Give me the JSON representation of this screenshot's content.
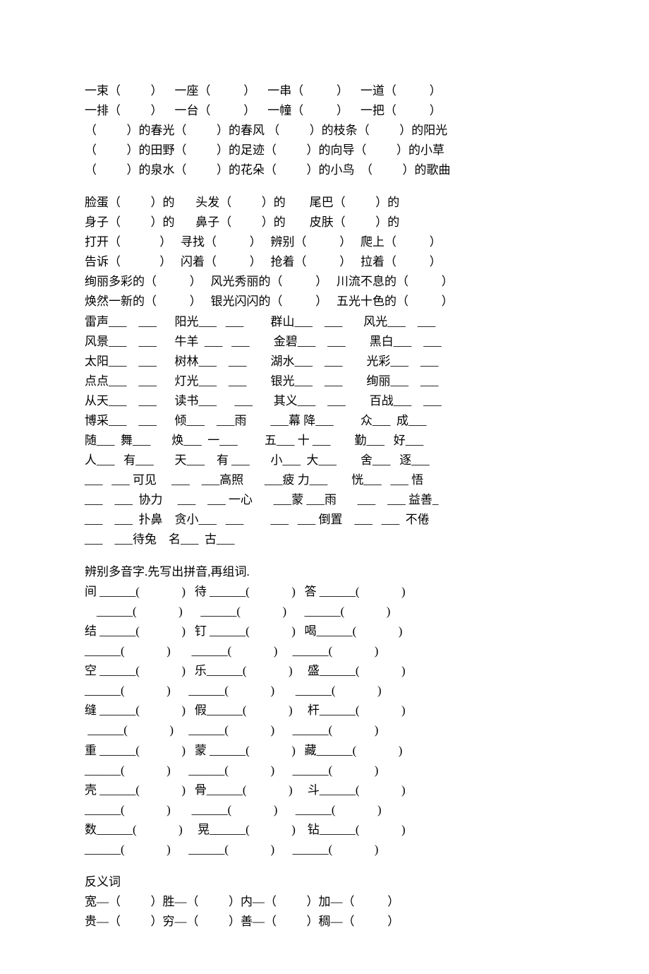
{
  "section1": {
    "l1": "一束（          ）    一座（           ）    一串（           ）    一道（           ）",
    "l2": "一排（          ）    一台（           ）    一幢（           ）    一把（           ）",
    "l3": "（          ）的春光（          ）的春风 （          ）的枝条（          ）的阳光",
    "l4": "（          ）的田野（          ）的足迹（          ）的向导（          ）的小草",
    "l5": "（          ）的泉水（          ）的花朵（          ）的小鸟  （          ）的歌曲"
  },
  "section2": {
    "l1": "脸蛋（          ）的       头发（          ）的        尾巴（          ）的",
    "l2": "身子（          ）的       鼻子（          ）的        皮肤（          ）的",
    "l3": "打开（             ）   寻找（           ）   辨别（           ）   爬上（           ）",
    "l4": "告诉（             ）   闪着（           ）   抢着（           ）   拉着（           ）",
    "l5": "绚丽多彩的（           ）   风光秀丽的（           ）   川流不息的（           ）",
    "l6": "焕然一新的（           ）   银光闪闪的（           ）   五光十色的（           ）",
    "l7": "雷声___    ___      阳光___   ___         群山___    ___       风光___    ___",
    "l8": "风景___    ___      牛羊  ___   ___        金碧___    ___        黑白___    ___",
    "l9": "太阳___    ___      树林___    ___        湖水___    ___        光彩___    ___",
    "l10": "点点___    ___      灯光___    ___        银光___    ___        绚丽___    ___",
    "l11": "从天___    ___      读书___      ___       其义___    ___        百战___    ___",
    "l12": "博采___    ___      倾___    ___雨        ___幕 降___         众___  成___",
    "l13": "随___  舞___       焕___  一___         五___ 十 ___        勤___   好___",
    "l14": "人___   有___       天___    有 ___       小___  大___        舍___   逐___",
    "l15": "___   ___ 可见     ___    ___高照       ___疲 力___        恍___   ___ 悟",
    "l16": "___    ___  协力     ___    ___ 一心       ___蒙 ___雨       ___    ___ 益善_",
    "l17": "___    ___  扑鼻    贪小___   ___         ___   ___ 倒置    ___   ___  不倦",
    "l18": "___    ___待兔    名___  古___"
  },
  "polyphonic": {
    "title": "辨别多音字.先写出拼音,再组词.",
    "rows": [
      {
        "a": "间 ______(              )",
        "b": "待 ______(              )",
        "c": "答 ______(              )"
      },
      {
        "a": "    ______(              )",
        "b": "    ______(              )",
        "c": "    ______(              )"
      },
      {
        "a": "结 ______(              )",
        "b": "钉 ______(              )",
        "c": "喝______(              )"
      },
      {
        "a": "______(              )",
        "b": " ______(              )",
        "c": "______(              )"
      },
      {
        "a": "空 ______(              )",
        "b": "乐______(              )",
        "c": " 盛______(              )"
      },
      {
        "a": "______(              )",
        "b": "______(              )",
        "c": " ______(              )"
      },
      {
        "a": "缝 ______(              )",
        "b": "假______(              )",
        "c": " 杆______(              )"
      },
      {
        "a": " ______(              )",
        "b": "______(              )",
        "c": "______(              )"
      },
      {
        "a": "重 ______(              )",
        "b": "蒙 ______(              )",
        "c": "藏______(              )"
      },
      {
        "a": "______(              )",
        "b": "______(              )",
        "c": "______(              )"
      },
      {
        "a": "壳 ______(              )",
        "b": "骨______(              )",
        "c": " 斗______(              )"
      },
      {
        "a": "______(              )",
        "b": " ______(              )",
        "c": " ______(              )"
      },
      {
        "a": "数______(              )",
        "b": " 晃______(              )",
        "c": " 钻______(              )"
      },
      {
        "a": "______(              )",
        "b": "______(              )",
        "c": "______(              )"
      }
    ]
  },
  "antonyms": {
    "title": "反义词",
    "l1": "宽—（          ）胜—（          ）内—（          ）加—（           ）",
    "l2": "贵—（          ）穷—（          ）善—（          ）稠—（           ）"
  }
}
